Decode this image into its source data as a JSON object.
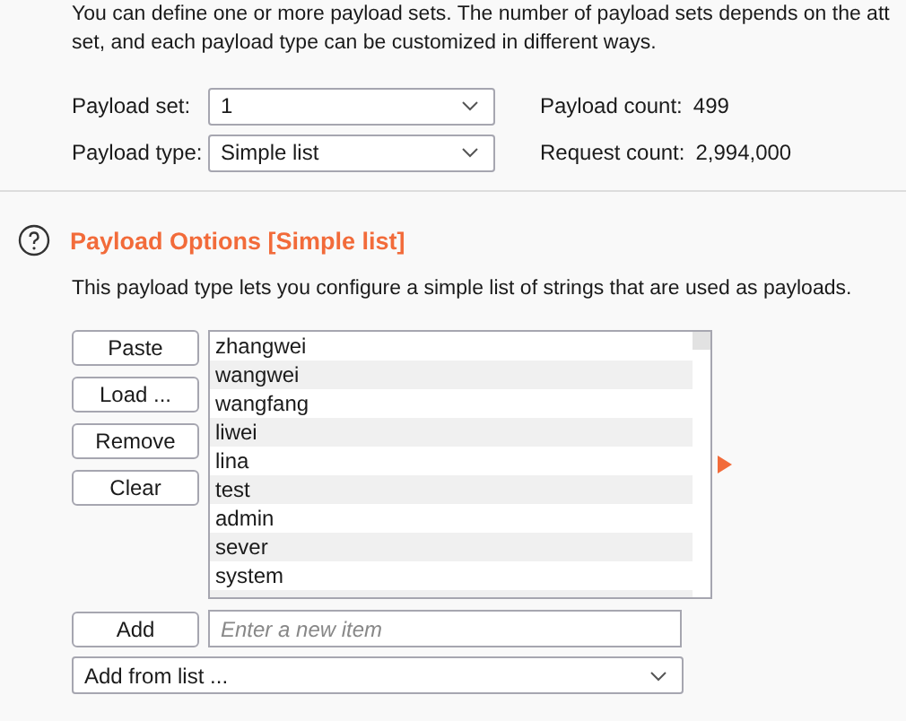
{
  "intro": "You can define one or more payload sets. The number of payload sets depends on the att set, and each payload type can be customized in different ways.",
  "payload_set": {
    "label": "Payload set:",
    "value": "1"
  },
  "payload_type": {
    "label": "Payload type:",
    "value": "Simple list"
  },
  "payload_count": {
    "label": "Payload count:",
    "value": "499"
  },
  "request_count": {
    "label": "Request count:",
    "value": "2,994,000"
  },
  "options": {
    "title": "Payload Options [Simple list]",
    "description": "This payload type lets you configure a simple list of strings that are used as payloads."
  },
  "buttons": [
    "Paste",
    "Load ...",
    "Remove",
    "Clear"
  ],
  "items": [
    "zhangwei",
    "wangwei",
    "wangfang",
    "liwei",
    "lina",
    "test",
    "admin",
    "sever",
    "system"
  ],
  "add_button": "Add",
  "new_item": {
    "placeholder": "Enter a new item"
  },
  "add_from_list": {
    "value": "Add from list ..."
  }
}
